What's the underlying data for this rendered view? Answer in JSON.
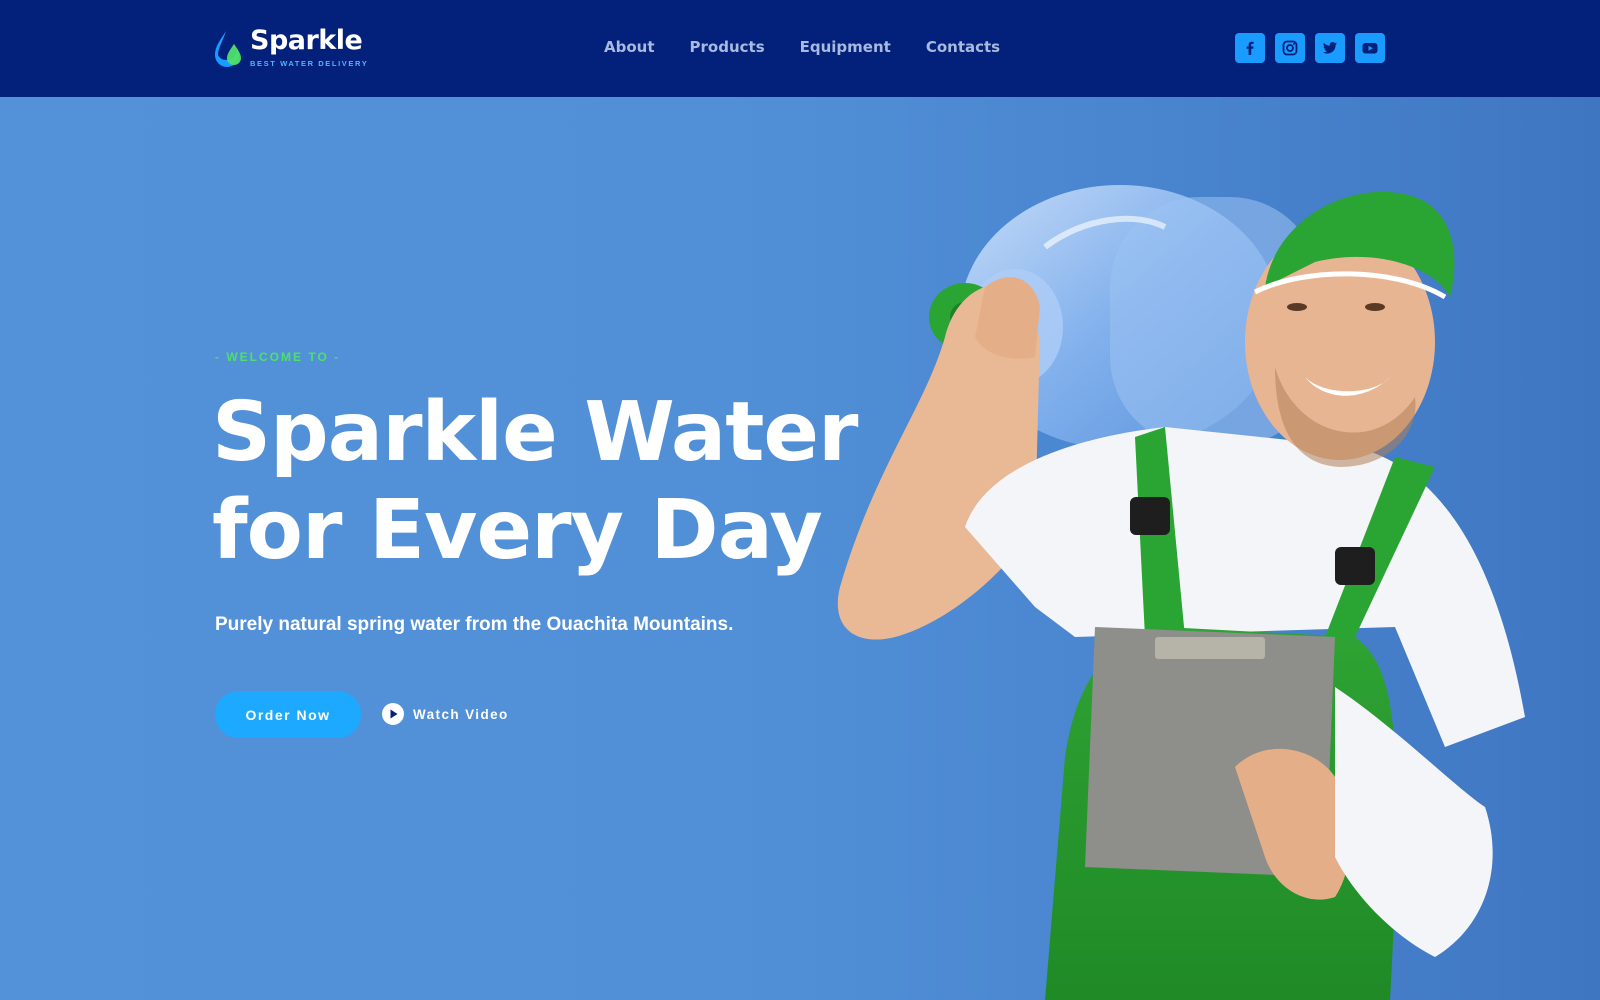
{
  "brand": {
    "name": "Sparkle",
    "tagline": "BEST WATER DELIVERY",
    "accent": "#1da9ff",
    "green": "#4ee06a",
    "header_bg": "#03217a"
  },
  "nav": {
    "items": [
      "About",
      "Products",
      "Equipment",
      "Contacts"
    ]
  },
  "social": {
    "icons": [
      "facebook-icon",
      "instagram-icon",
      "twitter-icon",
      "youtube-icon"
    ]
  },
  "hero": {
    "eyebrow": "- WELCOME TO -",
    "headline_line1": "Sparkle Water",
    "headline_line2": "for Every Day",
    "subtext": "Purely natural spring water from the Ouachita Mountains.",
    "order_label": "Order Now",
    "watch_label": "Watch Video"
  }
}
